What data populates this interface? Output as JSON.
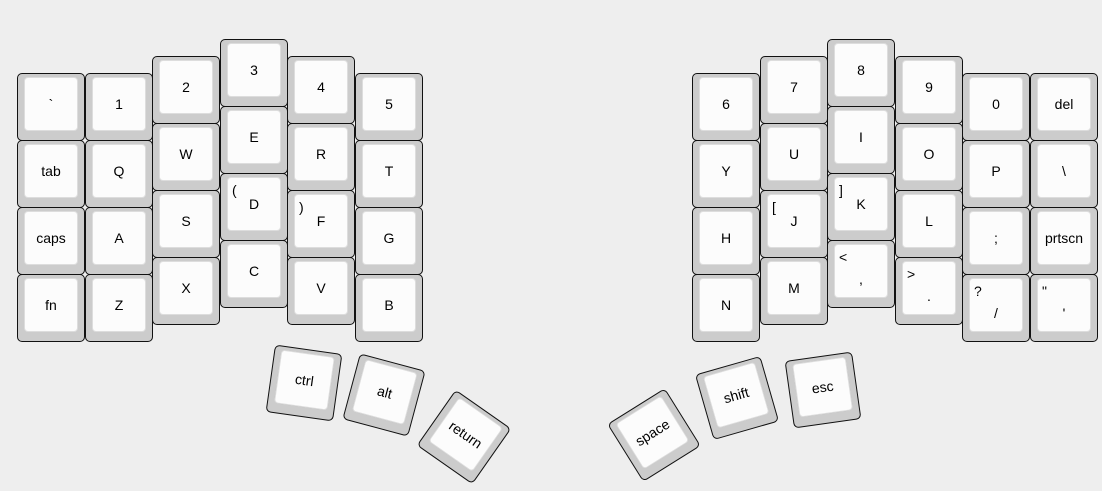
{
  "keys": [
    {
      "id": "backtick",
      "label": "`"
    },
    {
      "id": "1",
      "label": "1"
    },
    {
      "id": "2",
      "label": "2"
    },
    {
      "id": "3",
      "label": "3"
    },
    {
      "id": "4",
      "label": "4"
    },
    {
      "id": "5",
      "label": "5"
    },
    {
      "id": "tab",
      "label": "tab"
    },
    {
      "id": "q",
      "label": "Q"
    },
    {
      "id": "w",
      "label": "W"
    },
    {
      "id": "e",
      "label": "E"
    },
    {
      "id": "r",
      "label": "R"
    },
    {
      "id": "t",
      "label": "T"
    },
    {
      "id": "caps",
      "label": "caps"
    },
    {
      "id": "a",
      "label": "A"
    },
    {
      "id": "s",
      "label": "S"
    },
    {
      "id": "d",
      "label": "D",
      "shift": "("
    },
    {
      "id": "f",
      "label": "F",
      "shift": ")"
    },
    {
      "id": "g",
      "label": "G"
    },
    {
      "id": "fn",
      "label": "fn"
    },
    {
      "id": "z",
      "label": "Z"
    },
    {
      "id": "x",
      "label": "X"
    },
    {
      "id": "c",
      "label": "C"
    },
    {
      "id": "v",
      "label": "V"
    },
    {
      "id": "b",
      "label": "B"
    },
    {
      "id": "6",
      "label": "6"
    },
    {
      "id": "7",
      "label": "7"
    },
    {
      "id": "8",
      "label": "8"
    },
    {
      "id": "9",
      "label": "9"
    },
    {
      "id": "0",
      "label": "0"
    },
    {
      "id": "del",
      "label": "del"
    },
    {
      "id": "y",
      "label": "Y"
    },
    {
      "id": "u",
      "label": "U"
    },
    {
      "id": "i",
      "label": "I"
    },
    {
      "id": "o",
      "label": "O"
    },
    {
      "id": "p",
      "label": "P"
    },
    {
      "id": "backslash",
      "label": "\\"
    },
    {
      "id": "h",
      "label": "H"
    },
    {
      "id": "j",
      "label": "J",
      "shift": "["
    },
    {
      "id": "k",
      "label": "K",
      "shift": "]"
    },
    {
      "id": "l",
      "label": "L"
    },
    {
      "id": "semicolon",
      "label": ";"
    },
    {
      "id": "prtscn",
      "label": "prtscn"
    },
    {
      "id": "n",
      "label": "N"
    },
    {
      "id": "m",
      "label": "M"
    },
    {
      "id": "comma",
      "label": ",",
      "shift": "<"
    },
    {
      "id": "period",
      "label": ".",
      "shift": ">"
    },
    {
      "id": "slash",
      "label": "/",
      "shift": "?"
    },
    {
      "id": "quote",
      "label": "'",
      "shift": "\""
    },
    {
      "id": "ctrl",
      "label": "ctrl"
    },
    {
      "id": "alt",
      "label": "alt"
    },
    {
      "id": "return",
      "label": "return"
    },
    {
      "id": "space",
      "label": "space"
    },
    {
      "id": "shift",
      "label": "shift"
    },
    {
      "id": "esc",
      "label": "esc"
    }
  ]
}
